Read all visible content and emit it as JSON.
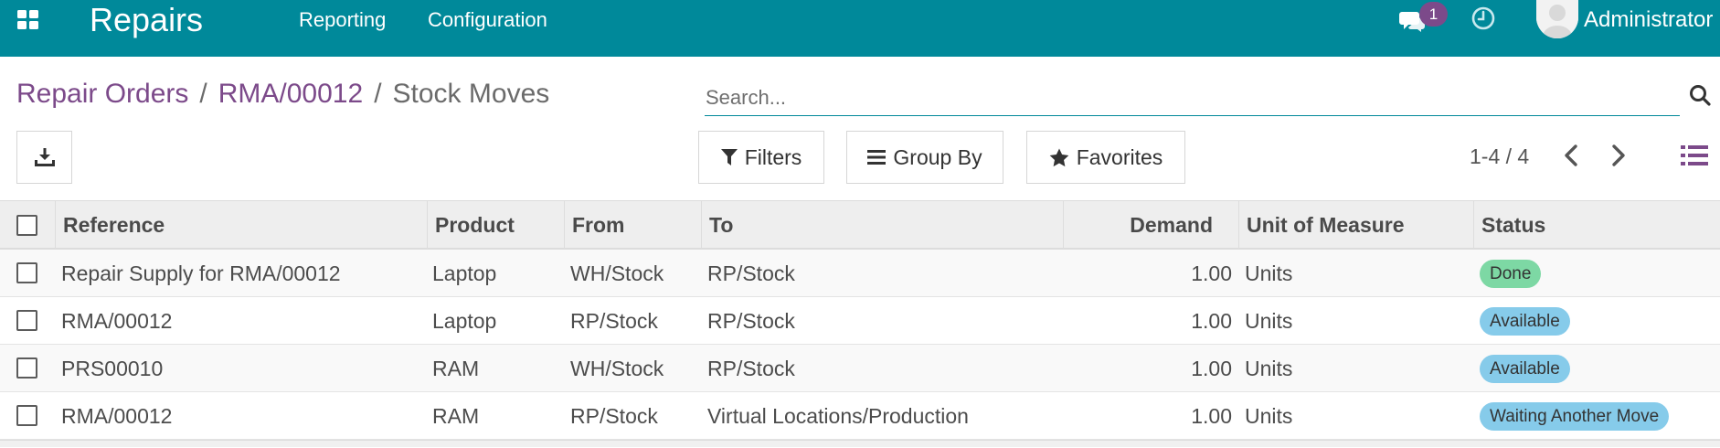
{
  "navbar": {
    "app_title": "Repairs",
    "menu": [
      "Reporting",
      "Configuration"
    ],
    "chat_badge_count": "1",
    "user_name": "Administrator",
    "colors": {
      "background": "#00899a",
      "badge": "#7c4a8a"
    },
    "icons": [
      "apps-grid-icon",
      "chat-icon",
      "clock-icon",
      "avatar"
    ]
  },
  "breadcrumb": {
    "items": [
      "Repair Orders",
      "RMA/00012",
      "Stock Moves"
    ],
    "separator": "/"
  },
  "search": {
    "placeholder": "Search...",
    "value": ""
  },
  "buttons": {
    "download_icon": "download-icon",
    "filters": "Filters",
    "group_by": "Group By",
    "favorites": "Favorites"
  },
  "pager": {
    "value": "1-4 / 4"
  },
  "table": {
    "columns": [
      "Reference",
      "Product",
      "From",
      "To",
      "Demand",
      "Unit of Measure",
      "Status"
    ],
    "rows": [
      {
        "reference": "Repair Supply for RMA/00012",
        "product": "Laptop",
        "from": "WH/Stock",
        "to": "RP/Stock",
        "demand": "1.00",
        "uom": "Units",
        "status": "Done"
      },
      {
        "reference": "RMA/00012",
        "product": "Laptop",
        "from": "RP/Stock",
        "to": "RP/Stock",
        "demand": "1.00",
        "uom": "Units",
        "status": "Available"
      },
      {
        "reference": "PRS00010",
        "product": "RAM",
        "from": "WH/Stock",
        "to": "RP/Stock",
        "demand": "1.00",
        "uom": "Units",
        "status": "Available"
      },
      {
        "reference": "RMA/00012",
        "product": "RAM",
        "from": "RP/Stock",
        "to": "Virtual Locations/Production",
        "demand": "1.00",
        "uom": "Units",
        "status": "Waiting Another Move"
      }
    ],
    "status_colors": {
      "Done": "#7dd8a4",
      "Available": "#86cbea",
      "Waiting Another Move": "#86cbea"
    }
  }
}
